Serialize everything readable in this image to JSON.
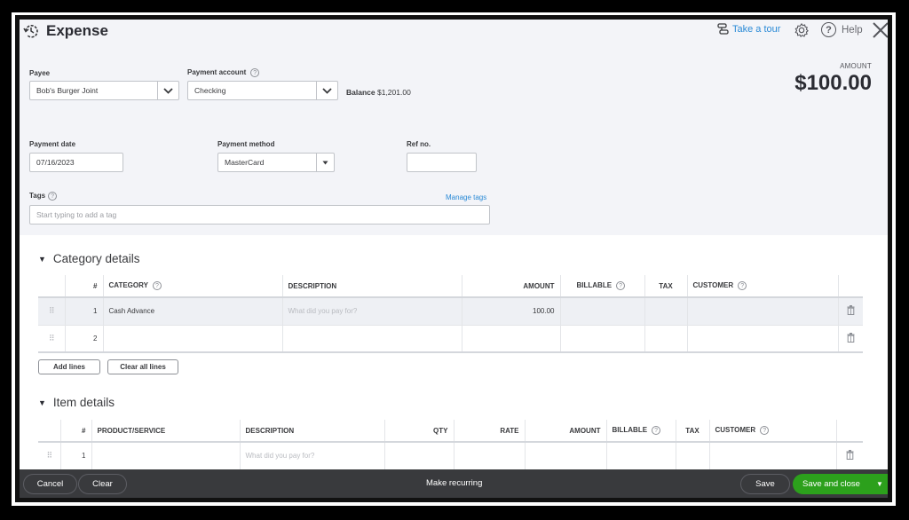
{
  "header": {
    "title": "Expense",
    "tour_label": "Take a tour",
    "help_label": "Help",
    "amount_label": "AMOUNT",
    "amount_value": "$100.00"
  },
  "form": {
    "payee": {
      "label": "Payee",
      "value": "Bob's Burger Joint"
    },
    "payment_account": {
      "label": "Payment account",
      "value": "Checking",
      "balance_label": "Balance",
      "balance_value": "$1,201.00"
    },
    "payment_date": {
      "label": "Payment date",
      "value": "07/16/2023"
    },
    "payment_method": {
      "label": "Payment method",
      "value": "MasterCard"
    },
    "ref_no": {
      "label": "Ref no.",
      "value": ""
    },
    "tags": {
      "label": "Tags",
      "placeholder": "Start typing to add a tag",
      "manage_label": "Manage tags"
    }
  },
  "category_details": {
    "title": "Category details",
    "columns": [
      "#",
      "CATEGORY",
      "DESCRIPTION",
      "AMOUNT",
      "BILLABLE",
      "TAX",
      "CUSTOMER"
    ],
    "rows": [
      {
        "num": "1",
        "category": "Cash Advance",
        "description_placeholder": "What did you pay for?",
        "amount": "100.00",
        "billable": "",
        "tax": "",
        "customer": ""
      },
      {
        "num": "2",
        "category": "",
        "description_placeholder": "",
        "amount": "",
        "billable": "",
        "tax": "",
        "customer": ""
      }
    ],
    "add_lines_label": "Add lines",
    "clear_lines_label": "Clear all lines"
  },
  "item_details": {
    "title": "Item details",
    "columns": [
      "#",
      "PRODUCT/SERVICE",
      "DESCRIPTION",
      "QTY",
      "RATE",
      "AMOUNT",
      "BILLABLE",
      "TAX",
      "CUSTOMER"
    ],
    "rows": [
      {
        "num": "1",
        "product": "",
        "description_placeholder": "What did you pay for?",
        "qty": "",
        "rate": "",
        "amount": "",
        "billable": "",
        "tax": "",
        "customer": ""
      }
    ]
  },
  "footer": {
    "cancel_label": "Cancel",
    "clear_label": "Clear",
    "recurring_label": "Make recurring",
    "save_label": "Save",
    "save_close_label": "Save and close"
  },
  "colors": {
    "accent_green": "#2ca01c",
    "link_blue": "#2a8ad6",
    "footer_bg": "#393a3d",
    "header_bg": "#f3f4f8"
  }
}
